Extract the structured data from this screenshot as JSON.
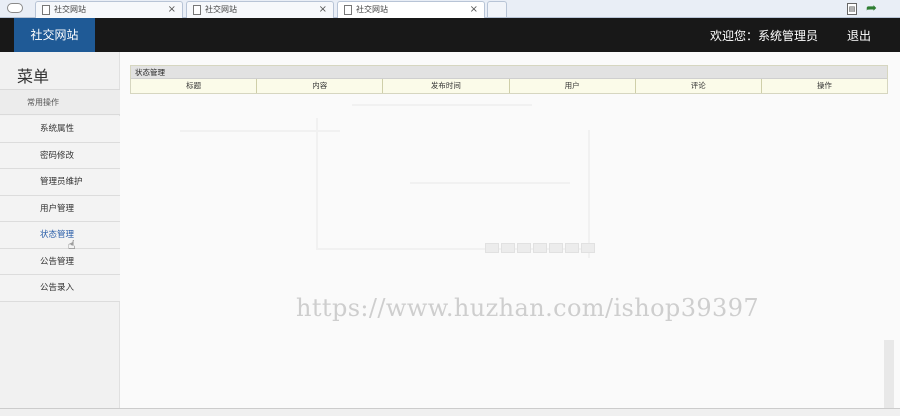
{
  "browser": {
    "tabs": [
      {
        "label": "社交网站"
      },
      {
        "label": "社交网站"
      },
      {
        "label": "社交网站"
      }
    ]
  },
  "header": {
    "site_title": "社交网站",
    "welcome": "欢迎您：系统管理员",
    "logout": "退出"
  },
  "sidebar": {
    "title": "菜单",
    "section": "常用操作",
    "items": [
      {
        "label": "系统属性"
      },
      {
        "label": "密码修改"
      },
      {
        "label": "管理员维护"
      },
      {
        "label": "用户管理"
      },
      {
        "label": "状态管理"
      },
      {
        "label": "公告管理"
      },
      {
        "label": "公告录入"
      }
    ],
    "active_index": 4
  },
  "panel": {
    "title": "状态管理",
    "columns": [
      "标题",
      "内容",
      "发布时间",
      "用户",
      "评论",
      "操作"
    ]
  },
  "watermark": "https://www.huzhan.com/ishop39397",
  "colors": {
    "header_bg": "#181818",
    "logo_bg": "#1f5a96",
    "active_link": "#2a5ea8",
    "table_header_bg": "#fbfbe9"
  },
  "icons": [
    "cloud-icon",
    "document-icon",
    "close-icon",
    "page-icon",
    "back-arrow-icon",
    "hand-cursor-icon"
  ]
}
